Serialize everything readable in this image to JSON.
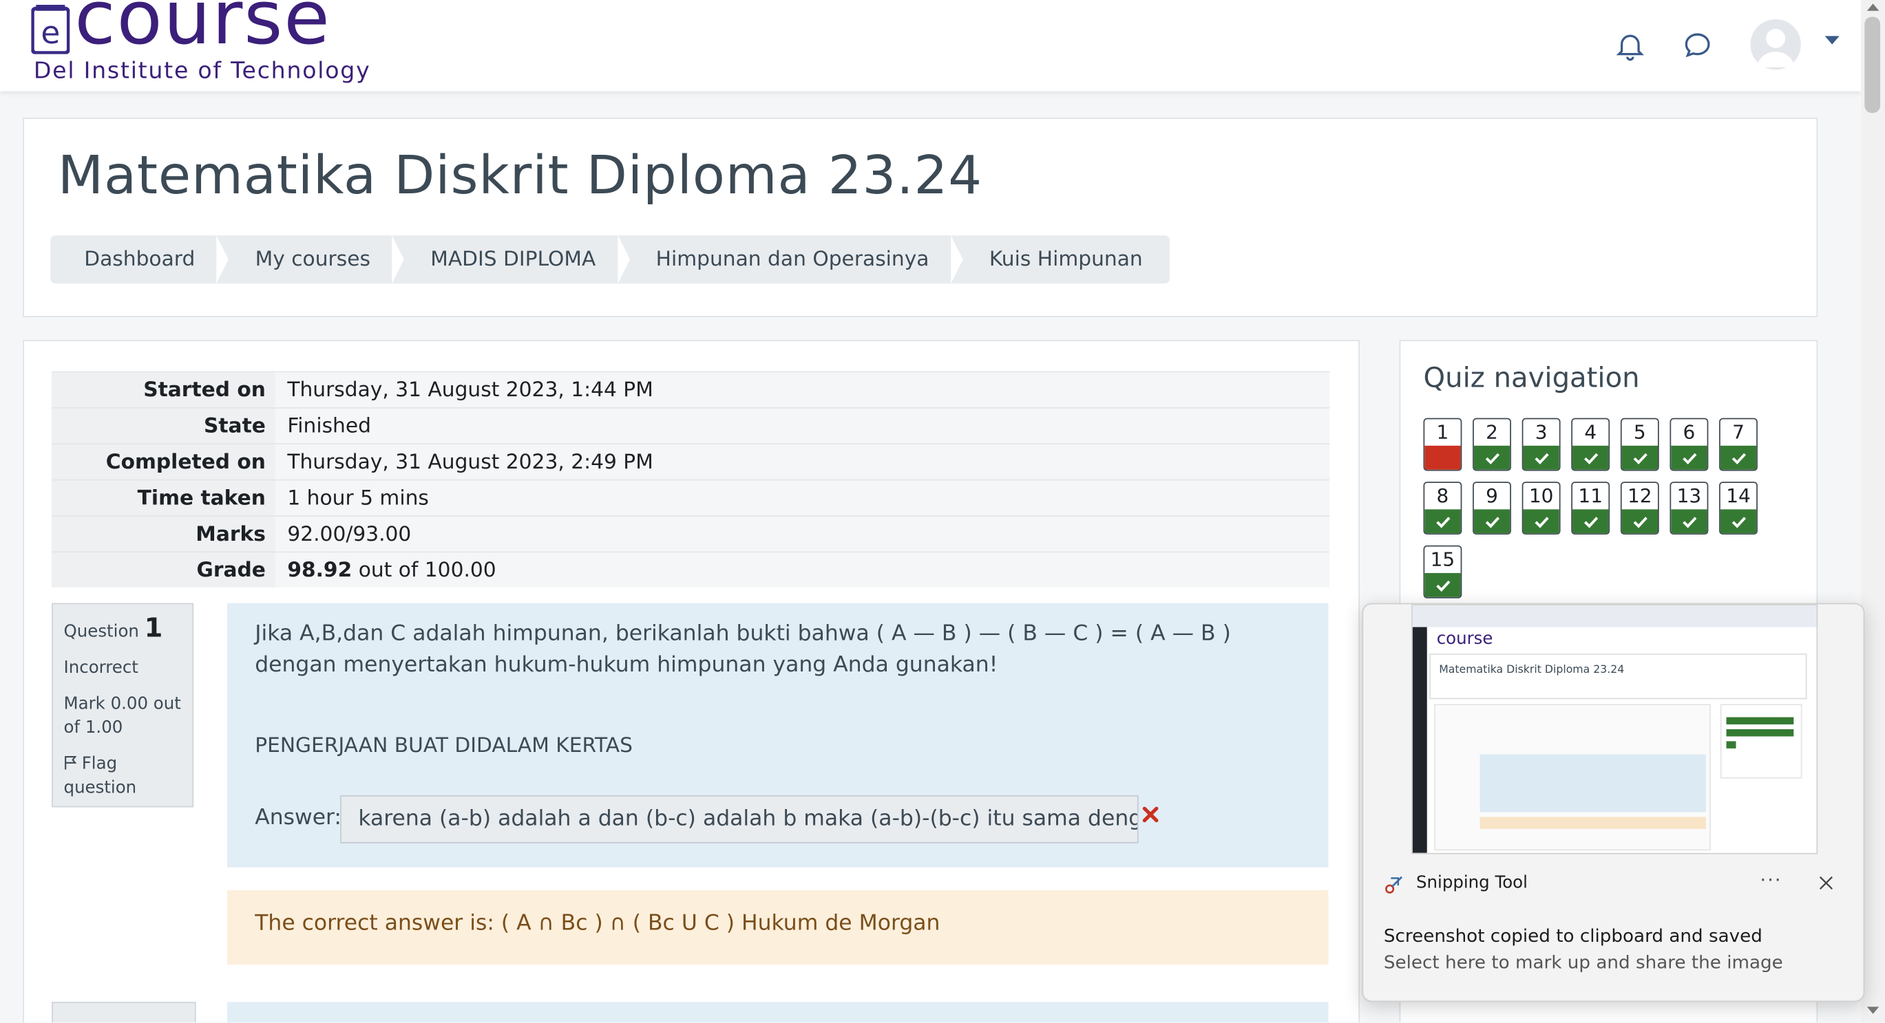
{
  "navbar": {
    "logo_word": "course",
    "logo_sub": "Del Institute of Technology"
  },
  "header": {
    "title": "Matematika Diskrit Diploma 23.24",
    "breadcrumb": [
      "Dashboard",
      "My courses",
      "MADIS DIPLOMA",
      "Himpunan dan Operasinya",
      "Kuis Himpunan"
    ]
  },
  "summary": [
    {
      "label": "Started on",
      "value": "Thursday, 31 August 2023, 1:44 PM"
    },
    {
      "label": "State",
      "value": "Finished"
    },
    {
      "label": "Completed on",
      "value": "Thursday, 31 August 2023, 2:49 PM"
    },
    {
      "label": "Time taken",
      "value": "1 hour 5 mins"
    },
    {
      "label": "Marks",
      "value": "92.00/93.00"
    },
    {
      "label": "Grade",
      "value_bold": "98.92",
      "value_rest": " out of 100.00"
    }
  ],
  "question": {
    "label": "Question",
    "number": "1",
    "status": "Incorrect",
    "mark": "Mark 0.00 out of 1.00",
    "flag": "Flag question",
    "text": "Jika A,B,dan C adalah himpunan, berikanlah bukti bahwa ( A — B ) — ( B — C ) = ( A — B ) dengan menyertakan hukum-hukum himpunan yang Anda gunakan!",
    "note": "PENGERJAAN BUAT DIDALAM KERTAS",
    "answer_label": "Answer:",
    "answer_value": "karena (a-b) adalah a dan (b-c) adalah b maka (a-b)-(b-c) itu sama dengan",
    "feedback": "The correct answer is: ( A ∩ Bc ) ∩ ( Bc U C ) Hukum de Morgan"
  },
  "quiz_nav": {
    "title": "Quiz navigation",
    "buttons": [
      {
        "n": "1",
        "state": "incorrect"
      },
      {
        "n": "2",
        "state": "correct"
      },
      {
        "n": "3",
        "state": "correct"
      },
      {
        "n": "4",
        "state": "correct"
      },
      {
        "n": "5",
        "state": "correct"
      },
      {
        "n": "6",
        "state": "correct"
      },
      {
        "n": "7",
        "state": "correct"
      },
      {
        "n": "8",
        "state": "correct"
      },
      {
        "n": "9",
        "state": "correct"
      },
      {
        "n": "10",
        "state": "correct"
      },
      {
        "n": "11",
        "state": "correct"
      },
      {
        "n": "12",
        "state": "correct"
      },
      {
        "n": "13",
        "state": "correct"
      },
      {
        "n": "14",
        "state": "correct"
      },
      {
        "n": "15",
        "state": "correct"
      }
    ]
  },
  "toast": {
    "app_name": "Snipping Tool",
    "more": "···",
    "message": "Screenshot copied to clipboard and saved",
    "sub_message": "Select here to mark up and share the image",
    "thumb_logo": "course",
    "thumb_title": "Matematika Diskrit Diploma 23.24"
  },
  "colors": {
    "brand": "#3b1f7a",
    "correct": "#357a32",
    "incorrect": "#ca3120",
    "question_bg": "#e2eef6",
    "feedback_bg": "#fcefdc"
  }
}
